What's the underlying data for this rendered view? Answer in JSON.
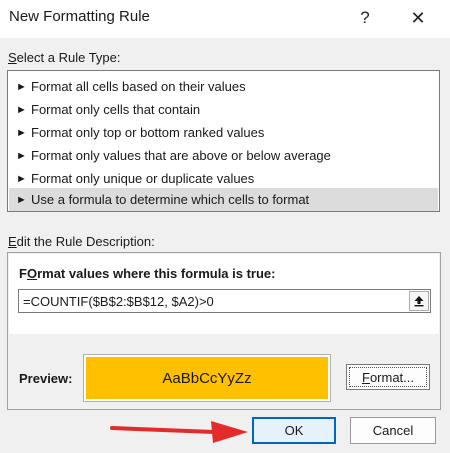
{
  "dialog": {
    "title": "New Formatting Rule",
    "help_glyph": "?",
    "close_glyph": "✕"
  },
  "rule_type": {
    "label_prefix": "",
    "label_accel": "S",
    "label_rest": "elect a Rule Type:",
    "items": [
      {
        "label": "Format all cells based on their values"
      },
      {
        "label": "Format only cells that contain"
      },
      {
        "label": "Format only top or bottom ranked values"
      },
      {
        "label": "Format only values that are above or below average"
      },
      {
        "label": "Format only unique or duplicate values"
      },
      {
        "label": "Use a formula to determine which cells to format",
        "selected": true
      }
    ],
    "bullet_glyph": "►"
  },
  "description": {
    "label_accel": "E",
    "label_rest": "dit the Rule Description:",
    "formula_title_accel": "O",
    "formula_title_pre": "F",
    "formula_title_rest": "rmat values where this formula is true:",
    "formula_value": "=COUNTIF($B$2:$B$12, $A2)>0",
    "preview_label": "Preview:",
    "preview_sample": "AaBbCcYyZz",
    "preview_fill_color": "#ffc000",
    "format_button_accel": "F",
    "format_button_rest": "ormat..."
  },
  "buttons": {
    "ok": "OK",
    "cancel": "Cancel"
  },
  "annotation": {
    "arrow_color": "#e32b2b"
  }
}
